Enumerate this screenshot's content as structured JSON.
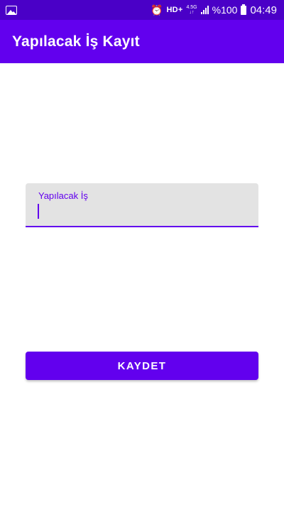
{
  "status_bar": {
    "left_icon": "gallery-icon",
    "alarm_icon": "alarm-clock-icon",
    "hd": "HD+",
    "network_top": "4.5G",
    "network_bottom": "↓↑",
    "signal_icon": "signal-bars-icon",
    "battery": "%100",
    "battery_icon": "battery-icon",
    "time": "04:49"
  },
  "app_bar": {
    "title": "Yapılacak İş Kayıt"
  },
  "form": {
    "task_field": {
      "label": "Yapılacak İş",
      "value": ""
    },
    "save_button": "KAYDET"
  },
  "colors": {
    "primary": "#6200ee",
    "status_bar": "#4a00c7",
    "field_background": "#e3e3e3"
  }
}
